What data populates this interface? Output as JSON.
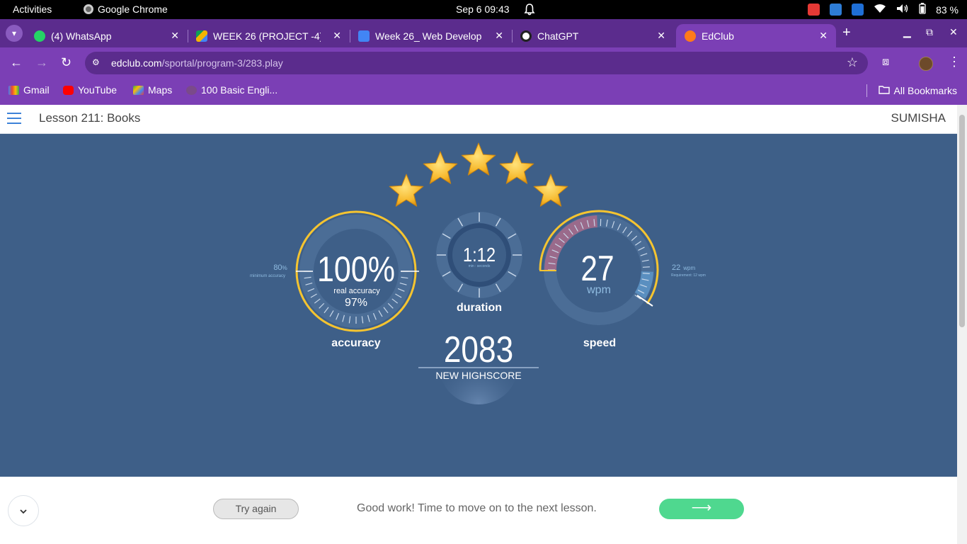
{
  "system_bar": {
    "activities": "Activities",
    "app_name": "Google Chrome",
    "clock": "Sep 6  09:43",
    "battery": "83 %"
  },
  "browser": {
    "tabs": [
      {
        "title": "(4) WhatsApp",
        "favicon_color": "#25d366"
      },
      {
        "title": "WEEK 26 (PROJECT -4)",
        "favicon_color": "#f4b400"
      },
      {
        "title": "Week 26_ Web Develop",
        "favicon_color": "#4285f4"
      },
      {
        "title": "ChatGPT",
        "favicon_color": "#ffffff"
      },
      {
        "title": "EdClub",
        "favicon_color": "#ff7a1a"
      }
    ],
    "active_tab": 4,
    "url_host": "edclub.com",
    "url_path": "/sportal/program-3/283.play",
    "bookmarks": [
      {
        "label": "Gmail",
        "icon": "gmail-icon"
      },
      {
        "label": "YouTube",
        "icon": "youtube-icon"
      },
      {
        "label": "Maps",
        "icon": "maps-icon"
      },
      {
        "label": "100 Basic Engli...",
        "icon": "bookmark-site-icon"
      }
    ],
    "all_bookmarks": "All Bookmarks"
  },
  "page": {
    "lesson_title": "Lesson 211: Books",
    "user_name": "SUMISHA"
  },
  "results": {
    "stars_earned": 5,
    "stars_total": 5,
    "accuracy": {
      "value": "100%",
      "fraction": 1.0,
      "real_label": "real accuracy",
      "real_value": "97%",
      "label": "accuracy",
      "min_value": "80",
      "min_unit": "%",
      "min_caption": "minimum accuracy"
    },
    "duration": {
      "value": "1:12",
      "caption": "min : seconds",
      "label": "duration"
    },
    "speed": {
      "value": "27",
      "unit": "wpm",
      "label": "speed",
      "req_value": "22",
      "req_unit": "wpm",
      "req_caption": "Requirement: 12 wpm"
    },
    "score": {
      "value": "2083",
      "label": "NEW HIGHSCORE"
    },
    "colors": {
      "panel": "#3e5f88",
      "gold": "#f5c430",
      "ring": "#4b6d96",
      "inner": "#2f4e78",
      "speed_red": "#9a6a8b",
      "speed_blue": "#5a8fc0"
    }
  },
  "footer": {
    "try_again": "Try again",
    "message": "Good work! Time to move on to the next lesson.",
    "next_arrow": "⟶"
  }
}
